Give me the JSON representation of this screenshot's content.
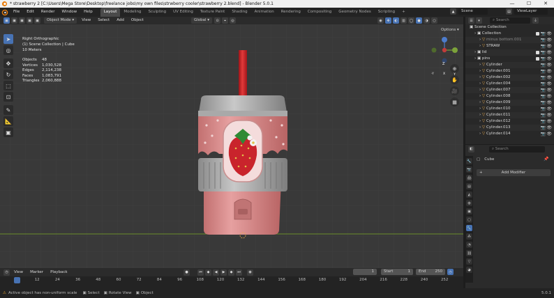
{
  "window": {
    "title": "* strawberry 2 [C:\\Users\\Mega Store\\Desktop\\freelance jobs\\my own files\\strwberry cooler\\strawberry 2.blend] - Blender 5.0.1",
    "minimize": "—",
    "maximize": "☐",
    "close": "✕"
  },
  "menu": {
    "items": [
      "File",
      "Edit",
      "Render",
      "Window",
      "Help"
    ],
    "workspaces": [
      "Layout",
      "Modeling",
      "Sculpting",
      "UV Editing",
      "Texture Paint",
      "Shading",
      "Animation",
      "Rendering",
      "Compositing",
      "Geometry Nodes",
      "Scripting"
    ],
    "active_workspace": "Layout",
    "scene": "Scene",
    "view_layer": "ViewLayer"
  },
  "viewport_header": {
    "mode": "Object Mode",
    "menus": [
      "View",
      "Select",
      "Add",
      "Object"
    ],
    "transform_orientation": "Global",
    "options": "Options"
  },
  "viewport": {
    "view_name": "Right Orthographic",
    "collection_line": "(1) Scene Collection | Cube",
    "scale": "10 Meters",
    "stats": [
      {
        "label": "Objects",
        "value": "48"
      },
      {
        "label": "Vertices",
        "value": "1,030,528"
      },
      {
        "label": "Edges",
        "value": "2,114,238"
      },
      {
        "label": "Faces",
        "value": "1,083,791"
      },
      {
        "label": "Triangles",
        "value": "2,060,888"
      }
    ],
    "gizmo_axes": {
      "z": "Z",
      "y": "Y",
      "neg_y": "-Y",
      "neg_x": "X"
    }
  },
  "timeline": {
    "menus": [
      "View",
      "Marker",
      "Playback"
    ],
    "current_frame": "1",
    "start_label": "Start",
    "start": "1",
    "end_label": "End",
    "end": "250",
    "ruler": [
      "1",
      "12",
      "24",
      "36",
      "48",
      "60",
      "72",
      "84",
      "96",
      "108",
      "120",
      "132",
      "144",
      "156",
      "168",
      "180",
      "192",
      "204",
      "216",
      "228",
      "240",
      "252"
    ]
  },
  "statusbar": {
    "message": "Active object has non-uniform scale",
    "hints": [
      "Select",
      "Rotate View",
      "Object"
    ],
    "version": "5.0.1"
  },
  "outliner": {
    "search_placeholder": "Search",
    "root": "Scene Collection",
    "rows": [
      {
        "label": "Collection",
        "indent": 1
      },
      {
        "label": "minus bottom.001",
        "indent": 2
      },
      {
        "label": "STRAW",
        "indent": 2
      },
      {
        "label": "lid",
        "indent": 1
      },
      {
        "label": "pins",
        "indent": 1
      },
      {
        "label": "Cylinder",
        "indent": 2
      },
      {
        "label": "Cylinder.001",
        "indent": 2
      },
      {
        "label": "Cylinder.002",
        "indent": 2
      },
      {
        "label": "Cylinder.004",
        "indent": 2
      },
      {
        "label": "Cylinder.007",
        "indent": 2
      },
      {
        "label": "Cylinder.008",
        "indent": 2
      },
      {
        "label": "Cylinder.009",
        "indent": 2
      },
      {
        "label": "Cylinder.010",
        "indent": 2
      },
      {
        "label": "Cylinder.011",
        "indent": 2
      },
      {
        "label": "Cylinder.012",
        "indent": 2
      },
      {
        "label": "Cylinder.013",
        "indent": 2
      },
      {
        "label": "Cylinder.014",
        "indent": 2
      }
    ]
  },
  "properties": {
    "search_placeholder": "Search",
    "object_name": "Cube",
    "add_modifier": "Add Modifier"
  },
  "colors": {
    "accent": "#4772b3",
    "viewport_bg": "#393939",
    "ground_line": "#6a8f2a",
    "straw": "#c8202a",
    "cup_pink": "#d98c8c",
    "lid_gray": "#9a9a9a"
  }
}
